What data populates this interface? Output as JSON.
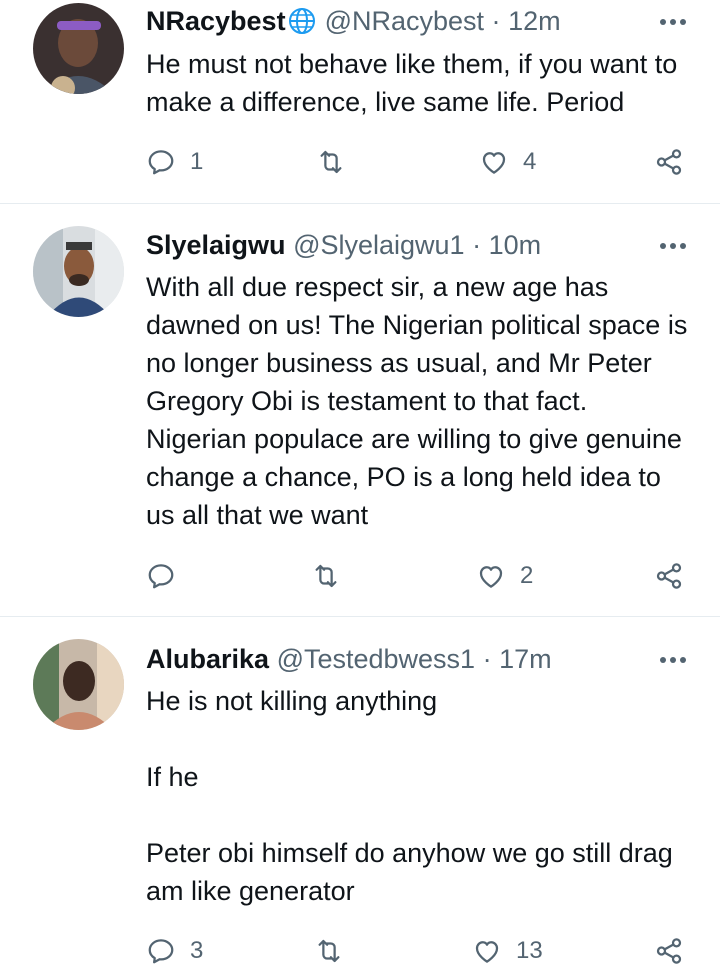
{
  "tweets": [
    {
      "name": "NRacybest",
      "handle": "@NRacybest",
      "time": "12m",
      "text": "He must not behave like them, if you want to make a difference, live same life. Period",
      "replies": "1",
      "retweets": "",
      "likes": "4",
      "verified_globe": true
    },
    {
      "name": "Slyelaigwu",
      "handle": "@Slyelaigwu1",
      "time": "10m",
      "text": "With all due respect sir, a new age has dawned on us! The Nigerian political space is no longer business as usual, and Mr Peter Gregory Obi is testament to that fact. Nigerian populace are willing to give genuine change a chance, PO is a long held idea to us all that we want",
      "replies": "",
      "retweets": "",
      "likes": "2"
    },
    {
      "name": "Alubarika",
      "handle": "@Testedbwess1",
      "time": "17m",
      "text": "He is not killing anything\n\nIf he\n\nPeter obi himself do anyhow we go still drag am like generator",
      "replies": "3",
      "retweets": "",
      "likes": "13"
    }
  ],
  "separator": "·",
  "icons": {
    "reply": "reply-icon",
    "retweet": "retweet-icon",
    "like": "heart-icon",
    "share": "share-icon",
    "more": "more-icon"
  },
  "colors": {
    "text": "#0f1419",
    "secondary": "#536471",
    "divider": "#e6ecf0",
    "globe": "#1d9bf0"
  }
}
